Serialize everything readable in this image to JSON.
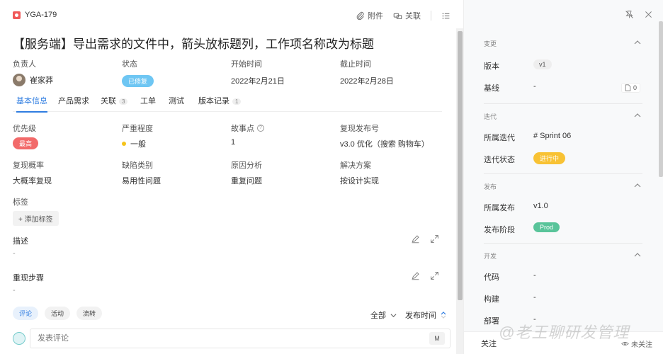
{
  "header": {
    "issue_id": "YGA-179",
    "attach_label": "附件",
    "link_label": "关联",
    "title": "【服务端】导出需求的文件中，箭头放标题列，工作项名称改为标题"
  },
  "meta": {
    "owner_label": "负责人",
    "owner_name": "崔家莽",
    "status_label": "状态",
    "status_value": "已修复",
    "start_label": "开始时间",
    "start_value": "2022年2月21日",
    "due_label": "截止时间",
    "due_value": "2022年2月28日"
  },
  "tabs": [
    {
      "label": "基本信息",
      "count": ""
    },
    {
      "label": "产品需求",
      "count": ""
    },
    {
      "label": "关联",
      "count": "3"
    },
    {
      "label": "工单",
      "count": ""
    },
    {
      "label": "测试",
      "count": ""
    },
    {
      "label": "版本记录",
      "count": "1"
    }
  ],
  "fields": {
    "priority_label": "优先级",
    "priority_value": "最高",
    "severity_label": "严重程度",
    "severity_value": "一般",
    "story_label": "故事点",
    "story_value": "1",
    "release_label": "复现发布号",
    "release_value": "v3.0 优化（搜索 购物车）",
    "prob_label": "复现概率",
    "prob_value": "大概率复现",
    "defect_label": "缺陷类别",
    "defect_value": "易用性问题",
    "cause_label": "原因分析",
    "cause_value": "重复问题",
    "solution_label": "解决方案",
    "solution_value": "按设计实现",
    "tags_label": "标签",
    "add_tag": "添加标签"
  },
  "sections": {
    "desc_label": "描述",
    "desc_value": "-",
    "steps_label": "重现步骤",
    "steps_value": "-"
  },
  "activity": {
    "chips": [
      "评论",
      "活动",
      "流转"
    ],
    "filter_label": "全部",
    "sort_label": "发布时间",
    "comment_placeholder": "发表评论",
    "m_label": "M"
  },
  "right": {
    "change": {
      "head": "变更",
      "version_label": "版本",
      "version_value": "v1",
      "baseline_label": "基线",
      "baseline_value": "-",
      "doc_count": "0"
    },
    "iteration": {
      "head": "迭代",
      "sprint_label": "所属迭代",
      "sprint_value": "# Sprint 06",
      "state_label": "迭代状态",
      "state_value": "进行中"
    },
    "release": {
      "head": "发布",
      "release_label": "所属发布",
      "release_value": "v1.0",
      "stage_label": "发布阶段",
      "stage_value": "Prod"
    },
    "dev": {
      "head": "开发",
      "code_label": "代码",
      "code_value": "-",
      "build_label": "构建",
      "build_value": "-",
      "deploy_label": "部署",
      "deploy_value": "-"
    },
    "footer": {
      "follow_label": "关注",
      "unfollow_label": "未关注"
    }
  },
  "watermark": "@老王聊研发管理",
  "colors": {
    "accent": "#2f7de1",
    "status_blue": "#6ec6f3",
    "priority_red": "#f26a6a",
    "iteration_yellow": "#f8c234",
    "prod_green": "#59c49a"
  }
}
